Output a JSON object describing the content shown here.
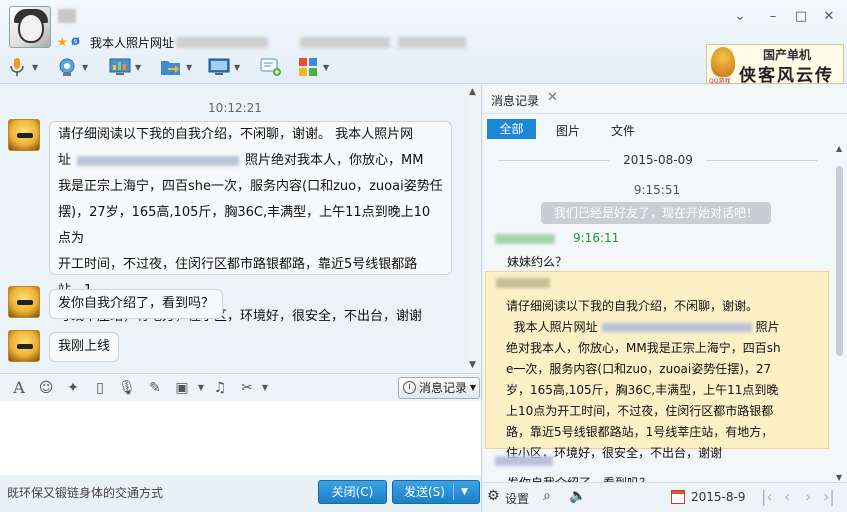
{
  "window": {
    "signature_prefix": "我本人照片网址",
    "controls": {
      "menu": "⌄",
      "minimize": "–",
      "maximize": "□",
      "close": "✕"
    }
  },
  "toolbar": {
    "items": [
      {
        "icon": "microphone-icon"
      },
      {
        "icon": "video-call-icon"
      },
      {
        "icon": "remote-assist-icon"
      },
      {
        "icon": "transfer-file-icon"
      },
      {
        "icon": "screen-share-icon"
      },
      {
        "icon": "new-discussion-icon"
      },
      {
        "icon": "apps-icon"
      }
    ]
  },
  "ad": {
    "line1": "国产单机",
    "line2": "侠客风云传",
    "logo_caption": "QQ游戏"
  },
  "chat": {
    "time": "10:12:21",
    "messages": [
      {
        "line1": "请仔细阅读以下我的自我介绍，不闲聊，谢谢。        我本人照片网",
        "line2a": "址",
        "line2b": "照片绝对我本人，你放心，MM",
        "line3": "我是正宗上海宁，四百she一次，服务内容(口和zuo，zuoai姿势任",
        "line4": "摆)，27岁，165高,105斤，胸36C,丰满型，上午11点到晚上10点为",
        "line5": "开工时间，不过夜，住闵行区都市路银都路，靠近5号线银都路站，1",
        "line6": "号线莘庄站，有地方，住小区，环境好，很安全，不出台，谢谢"
      },
      {
        "text": "发你自我介绍了，看到吗？"
      },
      {
        "text": "我刚上线"
      }
    ]
  },
  "input_toolbar": {
    "history_label": "消息记录"
  },
  "bottom": {
    "slogan": "既环保又锻链身体的交通方式",
    "close_label": "关闭(C)",
    "send_label": "发送(S)"
  },
  "history": {
    "title": "消息记录",
    "close": "✕",
    "filters": [
      "全部",
      "图片",
      "文件"
    ],
    "date": "2015-08-09",
    "time1": "9:15:51",
    "system_msg": "我们已经是好友了，现在开始对话吧！",
    "sender_time": "9:16:11",
    "msg1": "妹妹约么？",
    "highlight": {
      "line1": "请仔细阅读以下我的自我介绍，不闲聊，谢谢。",
      "line2a": "我本人照片网址",
      "line2b": "照片",
      "line3": "绝对我本人，你放心，MM我是正宗上海宁，四百sh",
      "line4": "e一次，服务内容(口和zuo，zuoai姿势任摆)，27",
      "line5": "岁，165高,105斤，胸36C,丰满型，上午11点到晚",
      "line6": "上10点为开工时间，不过夜，住闵行区都市路银都",
      "line7": "路，靠近5号线银都路站，1号线莘庄站，有地方，",
      "line8": "住小区，环境好，很安全，不出台，谢谢"
    },
    "partial_msg": "发你自我介绍了，看到吗？",
    "footer": {
      "settings": "设置",
      "date": "2015-8-9"
    }
  },
  "colors": {
    "accent": "#1e86d6",
    "green_time": "#1d9a3a",
    "highlight_bg": "#fdf0c6"
  }
}
